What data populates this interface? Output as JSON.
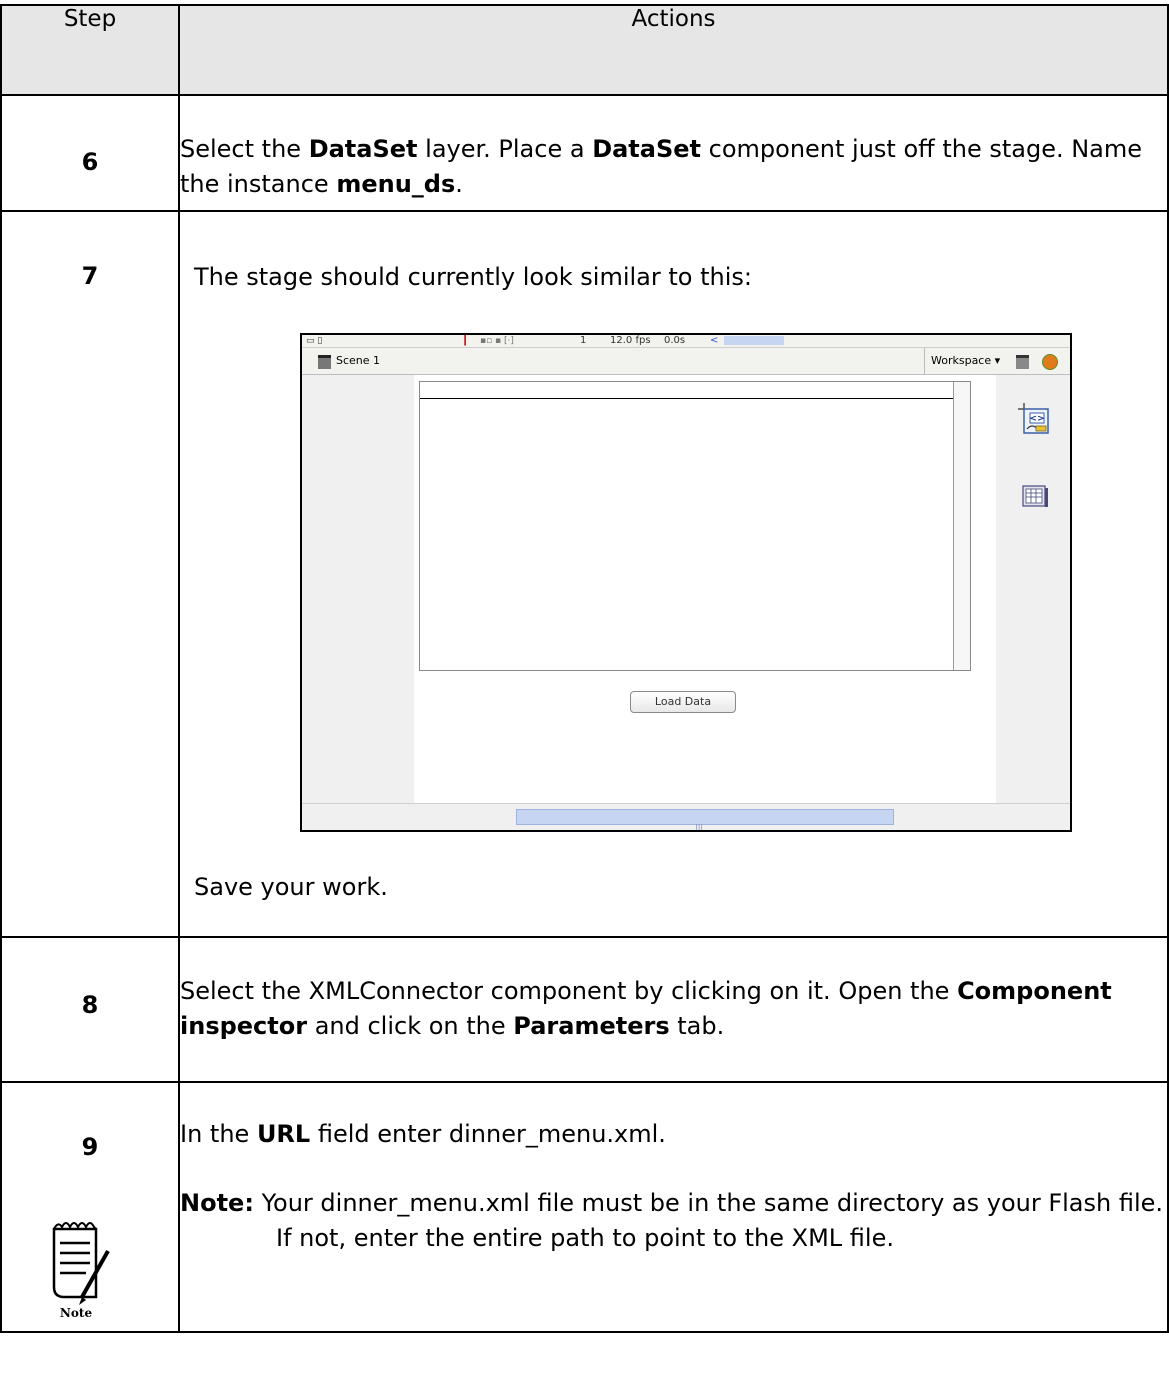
{
  "table": {
    "header": {
      "step": "Step",
      "actions": "Actions"
    }
  },
  "steps": [
    {
      "num": "6",
      "parts": [
        "Select the ",
        "DataSet",
        " layer. Place a ",
        "DataSet",
        " component just off the stage. Name the instance ",
        "menu_ds",
        "."
      ]
    },
    {
      "num": "7",
      "intro": "The stage should currently look similar to this:",
      "outro": "Save your work."
    },
    {
      "num": "8",
      "parts": [
        "Select the XMLConnector component by clicking on it. Open the ",
        "Component inspector",
        " and click on the ",
        "Parameters",
        " tab."
      ]
    },
    {
      "num": "9",
      "parts": [
        "In the ",
        "URL",
        " field enter dinner_menu.xml."
      ],
      "note_label": "Note:",
      "note_text": "Your dinner_menu.xml file must be in the same directory as your Flash file. If not, enter the entire path to point to the XML file.",
      "note_icon_caption": "Note"
    }
  ],
  "screenshot": {
    "timeline_frame": "1",
    "fps": "12.0 fps",
    "time": "0.0s",
    "scene_label": "Scene 1",
    "workspace_label": "Workspace ▾",
    "load_button": "Load Data",
    "icons": [
      "scene-clapper-icon",
      "xmlconnector-icon",
      "dataset-icon",
      "edit-symbols-icon",
      "edit-scene-icon"
    ]
  }
}
